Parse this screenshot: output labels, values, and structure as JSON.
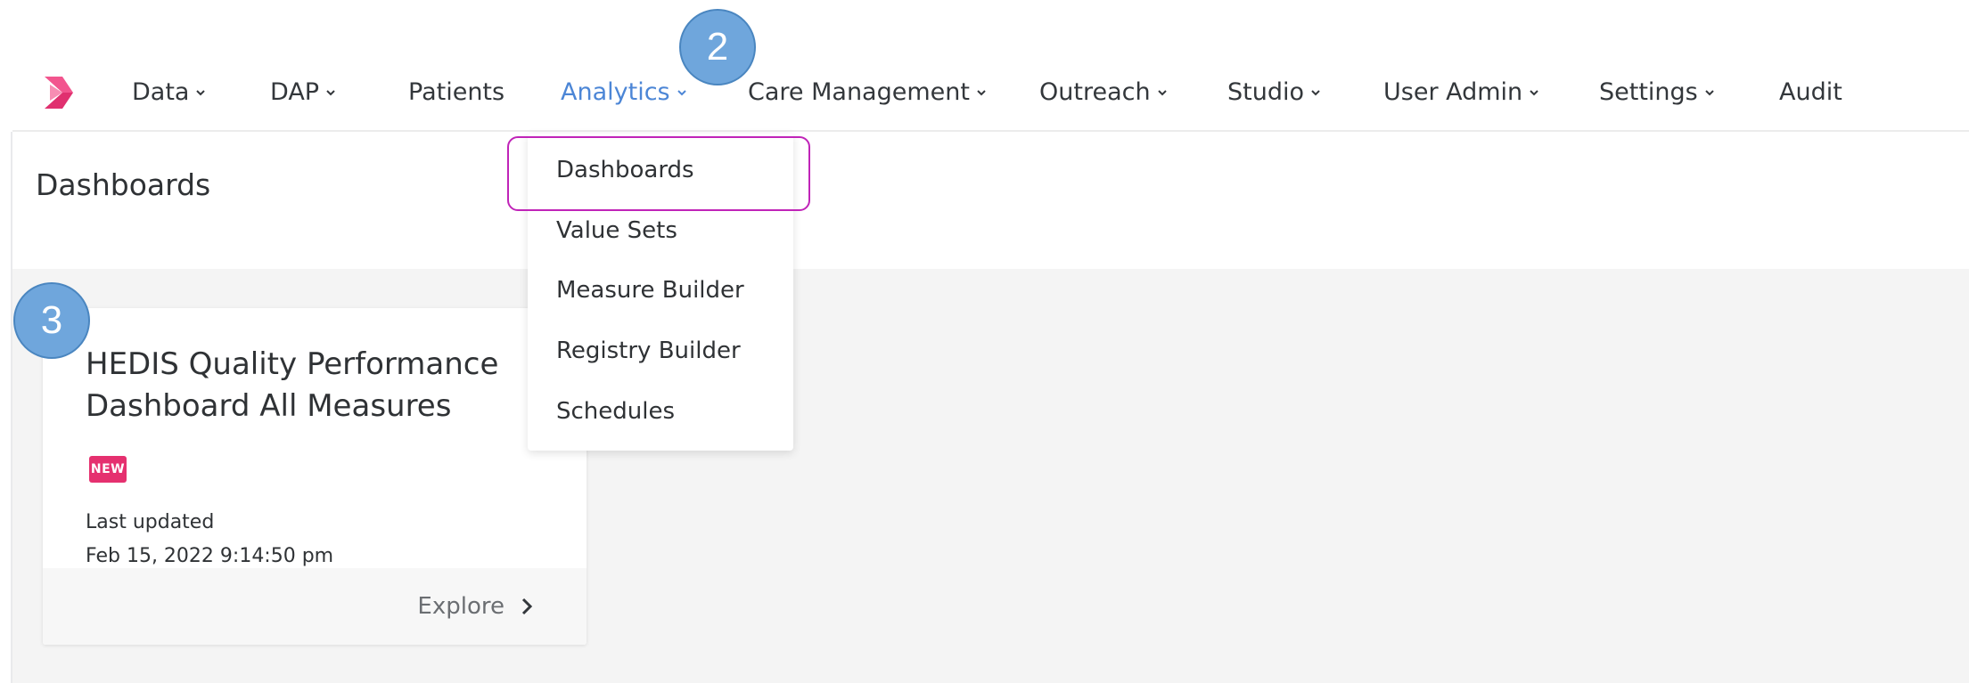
{
  "nav": {
    "items": [
      {
        "label": "Data",
        "has_chevron": true
      },
      {
        "label": "DAP",
        "has_chevron": true
      },
      {
        "label": "Patients",
        "has_chevron": false
      },
      {
        "label": "Analytics",
        "has_chevron": true,
        "active": true
      },
      {
        "label": "Care Management",
        "has_chevron": true
      },
      {
        "label": "Outreach",
        "has_chevron": true
      },
      {
        "label": "Studio",
        "has_chevron": true
      },
      {
        "label": "User Admin",
        "has_chevron": true
      },
      {
        "label": "Settings",
        "has_chevron": true
      },
      {
        "label": "Audit",
        "has_chevron": false
      }
    ],
    "active_color": "#4c86d6"
  },
  "page": {
    "title": "Dashboards"
  },
  "dropdown": {
    "items": [
      "Dashboards",
      "Value Sets",
      "Measure Builder",
      "Registry Builder",
      "Schedules"
    ],
    "highlighted": "Dashboards",
    "highlight_color": "#c024b8"
  },
  "card": {
    "title_line1": "HEDIS Quality Performance",
    "title_line2": "Dashboard All Measures",
    "badge": "NEW",
    "badge_color": "#e5306f",
    "updated_label": "Last updated",
    "updated_value": "Feb 15, 2022 9:14:50 pm",
    "explore_label": "Explore"
  },
  "annotations": {
    "step_2": "2",
    "step_3": "3",
    "color": "#6fa6dc"
  }
}
